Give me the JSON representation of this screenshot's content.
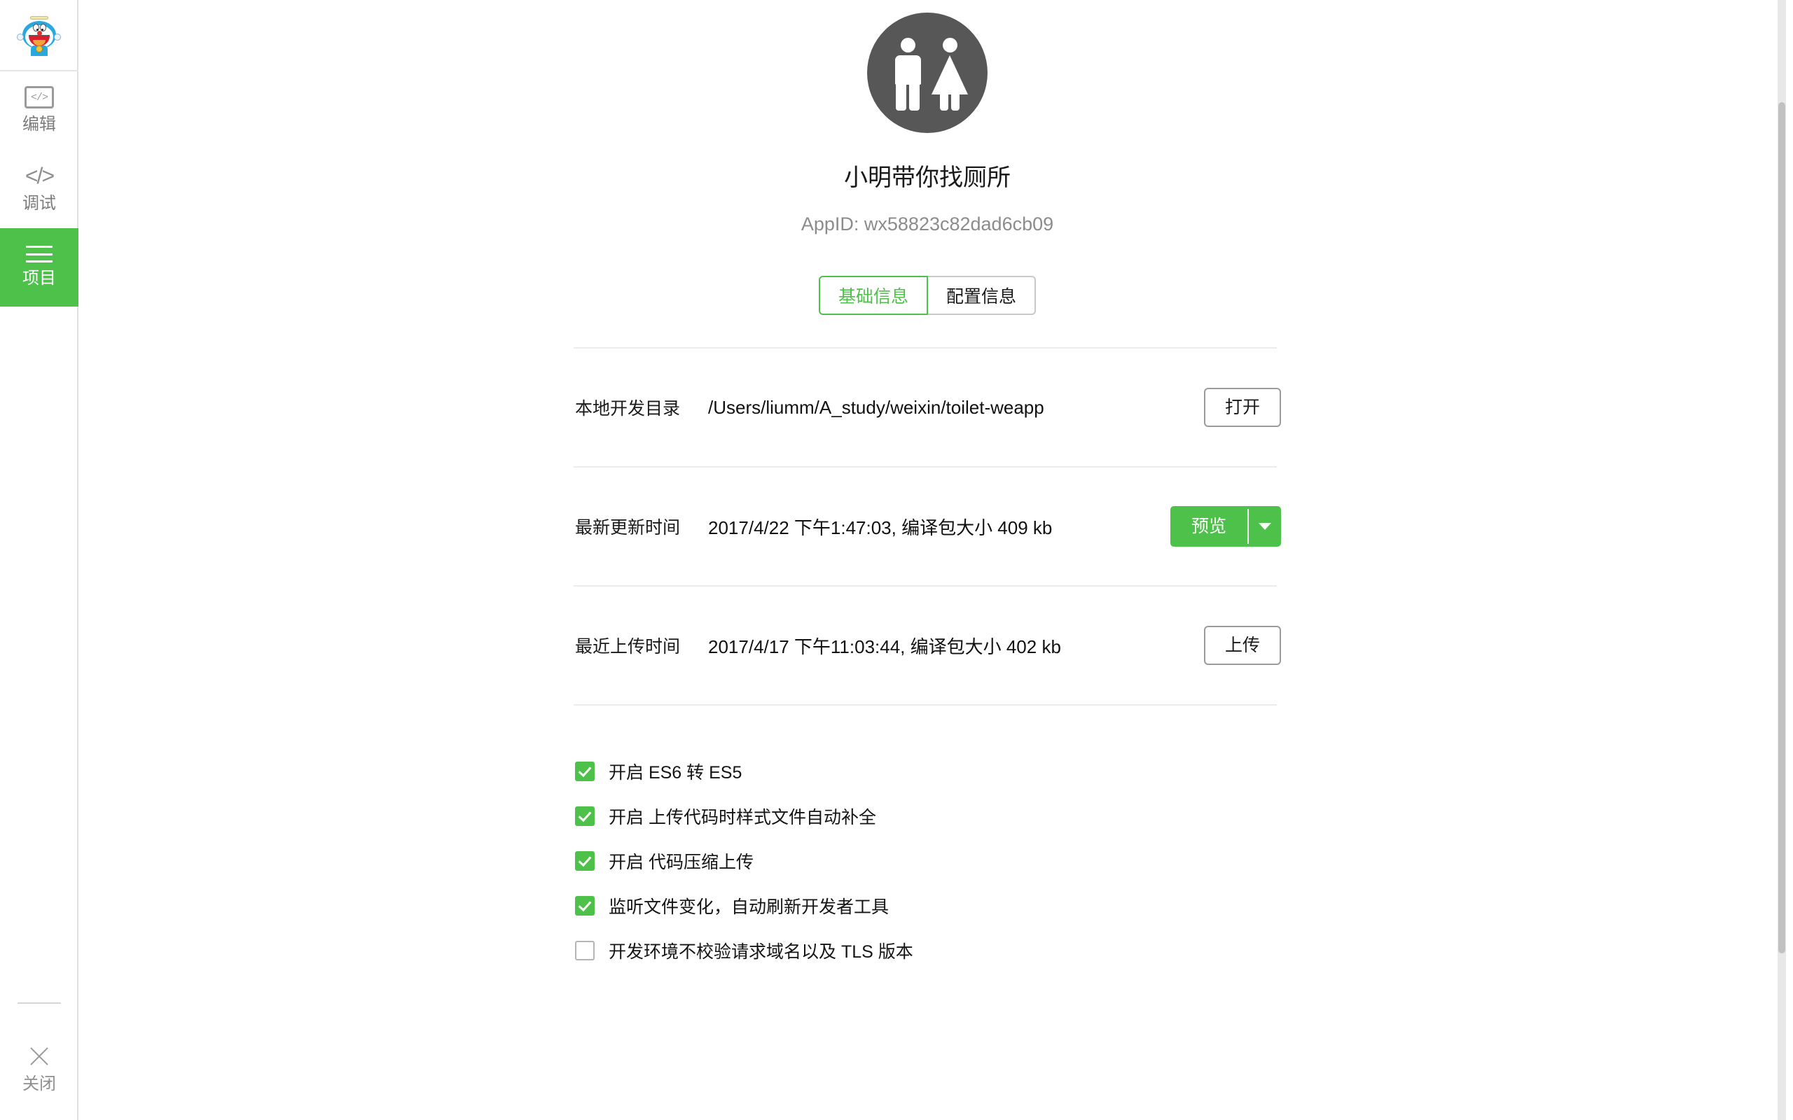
{
  "sidebar": {
    "avatar_name": "doraemon-avatar",
    "items": [
      {
        "label": "编辑",
        "icon": "code-box-icon",
        "active": false
      },
      {
        "label": "调试",
        "icon": "code-brackets-icon",
        "active": false
      },
      {
        "label": "项目",
        "icon": "hamburger-menu-icon",
        "active": true
      }
    ],
    "close": {
      "label": "关闭",
      "icon": "close-x-icon"
    },
    "active_color": "#4ec14a"
  },
  "header": {
    "app_icon": "restroom-sign-icon",
    "app_title": "小明带你找厕所",
    "app_id": "AppID: wx58823c82dad6cb09"
  },
  "tabs": [
    {
      "label": "基础信息",
      "active": true
    },
    {
      "label": "配置信息",
      "active": false
    }
  ],
  "rows": [
    {
      "label": "本地开发目录",
      "value": "/Users/liumm/A_study/weixin/toilet-weapp",
      "action": {
        "type": "button",
        "label": "打开"
      }
    },
    {
      "label": "最新更新时间",
      "value": "2017/4/22 下午1:47:03, 编译包大小 409 kb",
      "action": {
        "type": "split-button",
        "label": "预览",
        "dropdown_icon": "chevron-down-icon"
      }
    },
    {
      "label": "最近上传时间",
      "value": "2017/4/17 下午11:03:44, 编译包大小 402 kb",
      "action": {
        "type": "button",
        "label": "上传"
      }
    }
  ],
  "checkboxes": [
    {
      "label": "开启 ES6 转 ES5",
      "checked": true
    },
    {
      "label": "开启 上传代码时样式文件自动补全",
      "checked": true
    },
    {
      "label": "开启 代码压缩上传",
      "checked": true
    },
    {
      "label": "监听文件变化，自动刷新开发者工具",
      "checked": true
    },
    {
      "label": "开发环境不校验请求域名以及 TLS 版本",
      "checked": false
    }
  ]
}
